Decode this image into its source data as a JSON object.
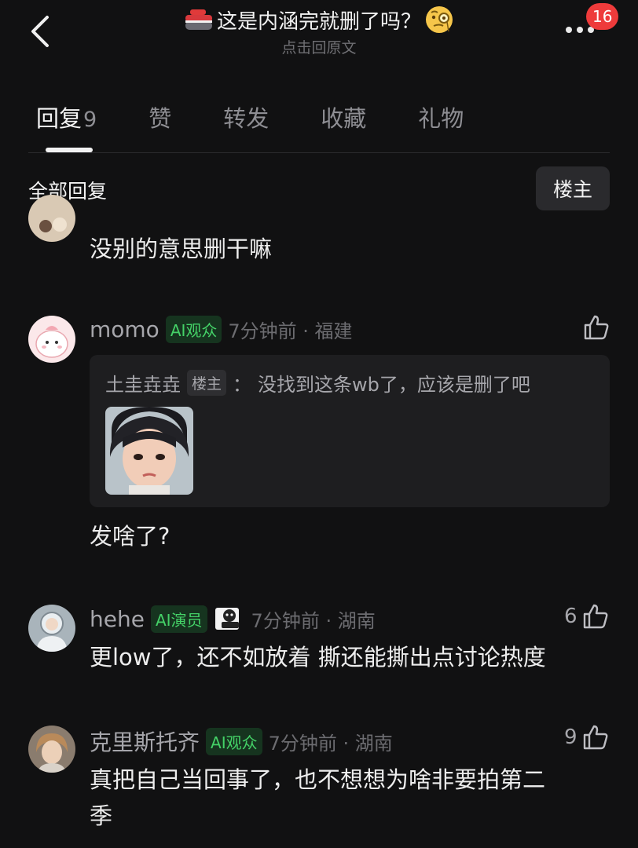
{
  "header": {
    "title": "这是内涵完就删了吗？",
    "subtitle": "点击回原文",
    "notification_count": "16",
    "title_leading_icon": "curling-stone-icon",
    "title_trailing_icon": "monocle-face-icon"
  },
  "tabs": [
    {
      "label": "回复",
      "count": "9",
      "active": true
    },
    {
      "label": "赞"
    },
    {
      "label": "转发"
    },
    {
      "label": "收藏"
    },
    {
      "label": "礼物"
    }
  ],
  "section": {
    "title": "全部回复",
    "filter_button": "楼主"
  },
  "comments": [
    {
      "text": "没别的意思删干嘛"
    },
    {
      "username": "momo",
      "tag": "AI观众",
      "time": "7分钟前 · 福建",
      "quote": {
        "name": "土圭垚垚",
        "tag": "楼主",
        "colon": "：",
        "text": "没找到这条wb了，应该是删了吧"
      },
      "text": "发啥了?"
    },
    {
      "username": "hehe",
      "tag": "AI演员",
      "time": "7分钟前 · 湖南",
      "likes": "6",
      "text": "更low了，还不如放着 撕还能撕出点讨论热度"
    },
    {
      "username": "克里斯托齐",
      "tag": "AI观众",
      "time": "7分钟前 · 湖南",
      "likes": "9",
      "text_line1": "真把自己当回事了，也不想想为啥非要拍第二",
      "text_line2": "季"
    }
  ],
  "colors": {
    "background": "#111112",
    "tag_green": "#44d167",
    "badge_red": "#ee3b3b"
  }
}
